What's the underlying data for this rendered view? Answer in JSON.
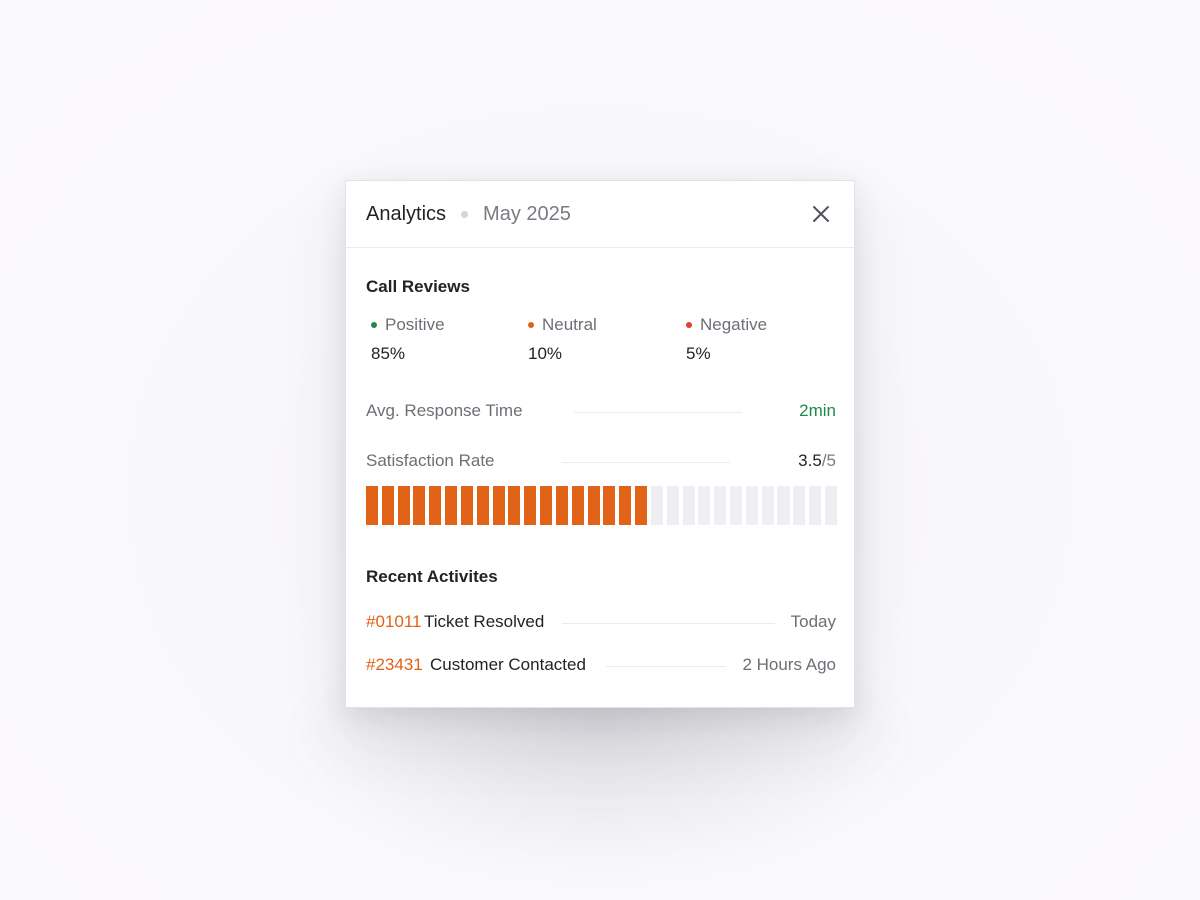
{
  "header": {
    "title": "Analytics",
    "period": "May 2025",
    "close_icon": "close-icon"
  },
  "call_reviews": {
    "title": "Call Reviews",
    "items": [
      {
        "label": "Positive",
        "value": "85%",
        "color": "#1e8a4a"
      },
      {
        "label": "Neutral",
        "value": "10%",
        "color": "#e06317"
      },
      {
        "label": "Negative",
        "value": "5%",
        "color": "#e0402f"
      }
    ]
  },
  "metrics": {
    "response_time": {
      "label": "Avg. Response Time",
      "value": "2min"
    },
    "satisfaction": {
      "label": "Satisfaction Rate",
      "score": "3.5",
      "denom": "/5",
      "total_segments": 30,
      "filled_segments": 18
    }
  },
  "colors": {
    "accent": "#e06317",
    "empty_segment": "#efeef2",
    "positive": "#1e8a4a"
  },
  "recent": {
    "title": "Recent Activites",
    "items": [
      {
        "id": "#01011",
        "text": "Ticket Resolved",
        "time": "Today"
      },
      {
        "id": "#23431",
        "text": "Customer Contacted",
        "time": "2 Hours Ago"
      }
    ]
  }
}
